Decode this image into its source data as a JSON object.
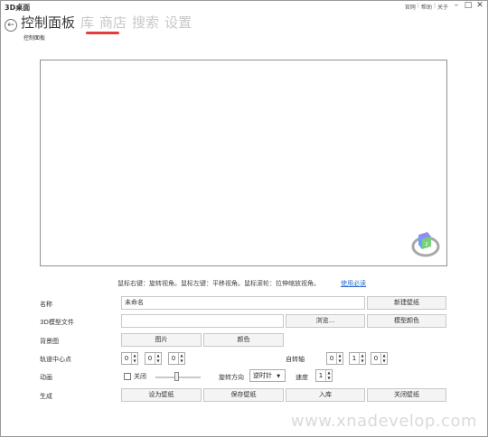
{
  "window": {
    "title": "3D桌面",
    "top_links": [
      "官网",
      "帮助",
      "关于"
    ],
    "controls": {
      "minimize": "–",
      "maximize": "□",
      "close": "✕"
    }
  },
  "nav": {
    "back_icon": "back-arrow-icon",
    "tabs": [
      {
        "label": "控制面板",
        "active": true
      },
      {
        "label": "库",
        "active": false
      },
      {
        "label": "商店",
        "active": false
      },
      {
        "label": "搜索",
        "active": false
      },
      {
        "label": "设置",
        "active": false
      }
    ],
    "underline_color": "#e53b3b"
  },
  "page": {
    "subtitle": "控制面板",
    "hint": "鼠标右键：旋转视角。鼠标左键：平移视角。鼠标滚轮：拉伸缩放视角。",
    "help_link": "使用必读"
  },
  "form": {
    "name": {
      "label": "名称",
      "value": "未命名",
      "new_button": "新建壁纸"
    },
    "model": {
      "label": "3D模型文件",
      "value": "",
      "browse_button": "浏览...",
      "color_button": "模型颜色"
    },
    "background": {
      "label": "背景图",
      "image_button": "图片",
      "color_button": "颜色"
    },
    "orbit": {
      "label": "轨道中心点",
      "x": "0",
      "y": "0",
      "z": "0"
    },
    "axis": {
      "label": "自转轴",
      "x": "0",
      "y": "1",
      "z": "0"
    },
    "animation": {
      "label": "动画",
      "checkbox_label": "关闭",
      "direction_label": "旋转方向",
      "direction_value": "逆时针",
      "speed_label": "速度",
      "speed_value": "1"
    },
    "generate": {
      "label": "生成",
      "buttons": [
        "设为壁纸",
        "保存壁纸",
        "入库",
        "关闭壁纸"
      ]
    }
  },
  "watermark": "www.xnadevelop.com"
}
